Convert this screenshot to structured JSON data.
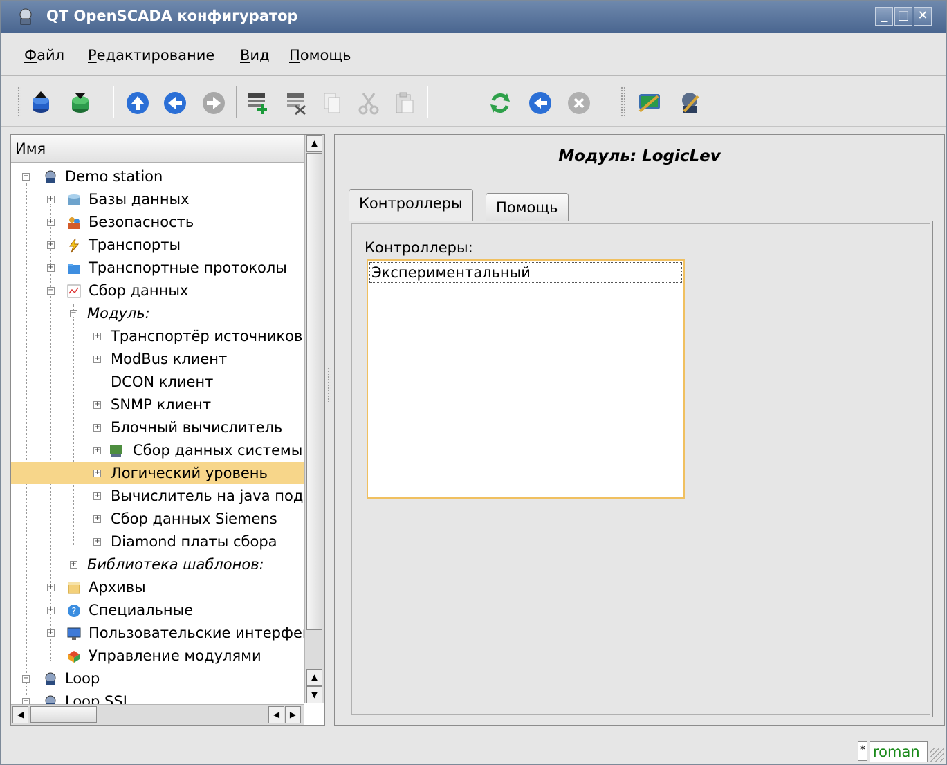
{
  "window": {
    "title": "QT OpenSCADA конфигуратор",
    "min": "_",
    "max": "□",
    "close": "✕"
  },
  "menu": [
    "Файл",
    "Редактирование",
    "Вид",
    "Помощь"
  ],
  "toolbar_icons": [
    "db-load-icon",
    "db-save-icon",
    "up-icon",
    "back-icon",
    "forward-icon",
    "add-item-icon",
    "delete-item-icon",
    "copy-icon",
    "cut-icon",
    "paste-icon",
    "refresh-icon",
    "start-icon",
    "stop-icon",
    "station-config-icon",
    "settings-icon"
  ],
  "tree": {
    "header": "Имя",
    "rows": [
      {
        "label": "Demo station"
      },
      {
        "label": "Базы данных"
      },
      {
        "label": "Безопасность"
      },
      {
        "label": "Транспорты"
      },
      {
        "label": "Транспортные протоколы"
      },
      {
        "label": "Сбор данных"
      },
      {
        "label": "Модуль:"
      },
      {
        "label": "Транспортёр источников"
      },
      {
        "label": "ModBus клиент"
      },
      {
        "label": "DCON клиент"
      },
      {
        "label": "SNMP клиент"
      },
      {
        "label": "Блочный вычислитель"
      },
      {
        "label": "Сбор данных системы"
      },
      {
        "label": "Логический уровень"
      },
      {
        "label": "Вычислитель на java подобном"
      },
      {
        "label": "Сбор данных Siemens"
      },
      {
        "label": "Diamond платы сбора"
      },
      {
        "label": "Библиотека шаблонов:"
      },
      {
        "label": "Архивы"
      },
      {
        "label": "Специальные"
      },
      {
        "label": "Пользовательские интерфейсы"
      },
      {
        "label": "Управление модулями"
      },
      {
        "label": "Loop"
      },
      {
        "label": "Loop SSL"
      }
    ]
  },
  "content": {
    "title": "Модуль: LogicLev",
    "tabs": [
      "Контроллеры",
      "Помощь"
    ],
    "controllers_label": "Контроллеры:",
    "controllers": [
      "Экспериментальный"
    ]
  },
  "status": {
    "modified": "*",
    "user": "roman"
  }
}
